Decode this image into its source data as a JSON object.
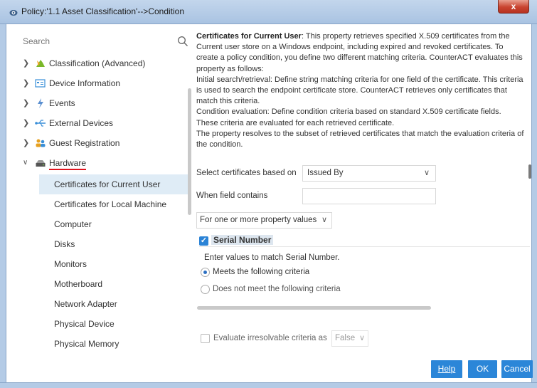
{
  "window": {
    "title": "Policy:'1.1 Asset Classification'-->Condition",
    "close_label": "x"
  },
  "search": {
    "placeholder": "Search"
  },
  "tree": {
    "groups": [
      {
        "label": "Classification (Advanced)",
        "icon": "classification-icon"
      },
      {
        "label": "Device Information",
        "icon": "device-info-icon"
      },
      {
        "label": "Events",
        "icon": "events-icon"
      },
      {
        "label": "External Devices",
        "icon": "usb-icon"
      },
      {
        "label": "Guest Registration",
        "icon": "guests-icon"
      },
      {
        "label": "Hardware",
        "icon": "hardware-icon"
      }
    ],
    "children": [
      "Certificates for Current User",
      "Certificates for Local Machine",
      "Computer",
      "Disks",
      "Monitors",
      "Motherboard",
      "Network Adapter",
      "Physical Device",
      "Physical Memory"
    ]
  },
  "description": {
    "title": "Certificates for Current User",
    "intro": ": This property retrieves specified X.509 certificates from the Current user store on a Windows endpoint, including expired and revoked certificates. To create a policy condition, you define two different matching criteria. CounterACT evaluates this property as follows:",
    "line1": "Initial search/retrieval: Define string matching criteria for one field of the certificate. This criteria is used to search the endpoint certificate store. CounterACT retrieves only certificates that match this criteria.",
    "line2": "Condition evaluation: Define condition criteria based on standard X.509 certificate fields. These criteria are evaluated for each retrieved certificate.",
    "line3": "The property resolves to the subset of retrieved certificates that match the evaluation criteria of the condition."
  },
  "form": {
    "select_label": "Select certificates based on",
    "select_value": "Issued By",
    "field_contains_label": "When field contains",
    "field_contains_value": "",
    "property_values_option": "For one or more property values",
    "serial_label": "Serial Number",
    "serial_checked": true,
    "serial_hint": "Enter values to match Serial Number.",
    "radio_meets": "Meets the following criteria",
    "radio_not_meet": "Does not meet the following criteria",
    "evaluate_label": "Evaluate irresolvable criteria as",
    "evaluate_value": "False"
  },
  "buttons": {
    "help": "Help",
    "ok": "OK",
    "cancel": "Cancel"
  },
  "colors": {
    "accent": "#2b86d8",
    "selection": "#dfecf6",
    "titlebar": "#b4cbe6"
  }
}
